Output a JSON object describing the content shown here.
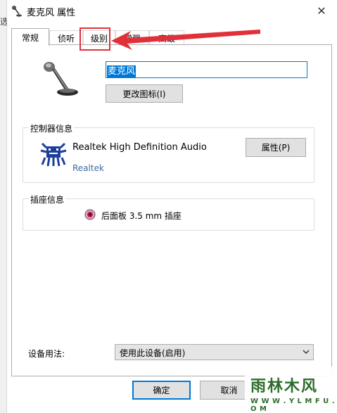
{
  "window": {
    "title": "麦克风 属性",
    "close_glyph": "✕"
  },
  "background_fragment": "选",
  "tabs": [
    {
      "label": "常规",
      "active": true
    },
    {
      "label": "侦听",
      "active": false
    },
    {
      "label": "级别",
      "active": false
    },
    {
      "label": "增强",
      "active": false
    },
    {
      "label": "高级",
      "active": false
    }
  ],
  "general": {
    "device_name": "麦克风",
    "change_icon_label": "更改图标(I)"
  },
  "controller": {
    "group_label": "控制器信息",
    "name": "Realtek High Definition Audio",
    "vendor_link": "Realtek",
    "properties_label": "属性(P)"
  },
  "jack": {
    "group_label": "插座信息",
    "description": "后面板 3.5 mm 插座",
    "color": "#c0185c"
  },
  "usage": {
    "label": "设备用法:",
    "selected": "使用此设备(启用)"
  },
  "footer": {
    "ok_label": "确定",
    "cancel_label": "取消"
  },
  "watermark": {
    "main": "雨林木风",
    "sub": "W W W . Y L M F U . C O M"
  },
  "colors": {
    "accent": "#0078d7",
    "annotation": "#e0313b",
    "link": "#3b6aa0"
  }
}
